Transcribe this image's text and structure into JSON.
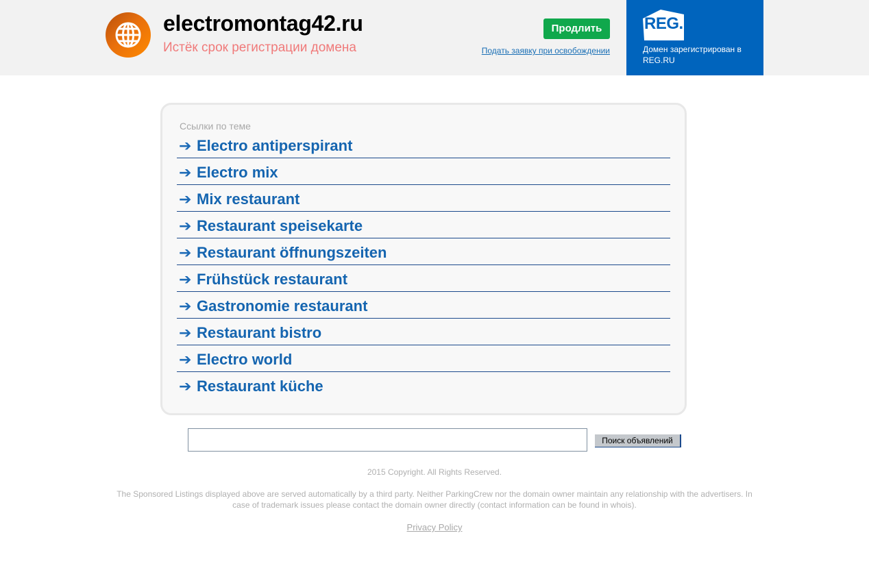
{
  "header": {
    "domain": "electromontag42.ru",
    "status": "Истёк срок регистрации домена",
    "renew_label": "Продлить",
    "request_link": "Подать заявку при освобождении"
  },
  "registrar": {
    "logo_text": "REG.RU",
    "note": "Домен зарегистрирован в REG.RU",
    "color": "#0064bd"
  },
  "links": {
    "title": "Ссылки по теме",
    "arrow": "➔",
    "items": [
      "Electro antiperspirant",
      "Electro mix",
      "Mix restaurant",
      "Restaurant speisekarte",
      "Restaurant öffnungszeiten",
      "Frühstück restaurant",
      "Gastronomie restaurant",
      "Restaurant bistro",
      "Electro world",
      "Restaurant küche"
    ]
  },
  "search": {
    "value": "",
    "button_label": "Поиск объявлений"
  },
  "footer": {
    "copyright": "2015 Copyright. All Rights Reserved.",
    "disclaimer": "The Sponsored Listings displayed above are served automatically by a third party. Neither ParkingCrew nor the domain owner maintain any relationship with the advertisers. In case of trademark issues please contact the domain owner directly (contact information can be found in whois).",
    "privacy": "Privacy Policy"
  },
  "colors": {
    "accent_link": "#1565b0",
    "renew_button": "#10a84c",
    "status_text": "#f07a7a"
  },
  "icons": [
    "globe-icon",
    "regru-logo-icon",
    "arrow-right-icon"
  ]
}
